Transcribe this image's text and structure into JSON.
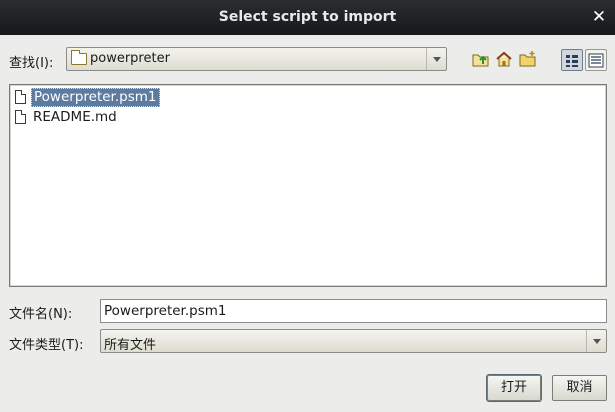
{
  "window": {
    "title": "Select script to import",
    "close_glyph": "✕"
  },
  "look_in": {
    "label": "查找(I):",
    "value": "powerpreter"
  },
  "toolbar": {
    "icons": [
      "up-one-level-icon",
      "home-icon",
      "new-folder-icon",
      "list-view-icon",
      "details-view-icon"
    ],
    "active_view": "list-view-icon"
  },
  "files": [
    {
      "name": "Powerpreter.psm1",
      "selected": true
    },
    {
      "name": "README.md",
      "selected": false
    }
  ],
  "file_name": {
    "label": "文件名(N):",
    "value": "Powerpreter.psm1"
  },
  "file_type": {
    "label": "文件类型(T):",
    "value": "所有文件"
  },
  "buttons": {
    "open": "打开",
    "cancel": "取消"
  },
  "colors": {
    "selection": "#5c7b9e",
    "titlebar": "#1f2124"
  }
}
